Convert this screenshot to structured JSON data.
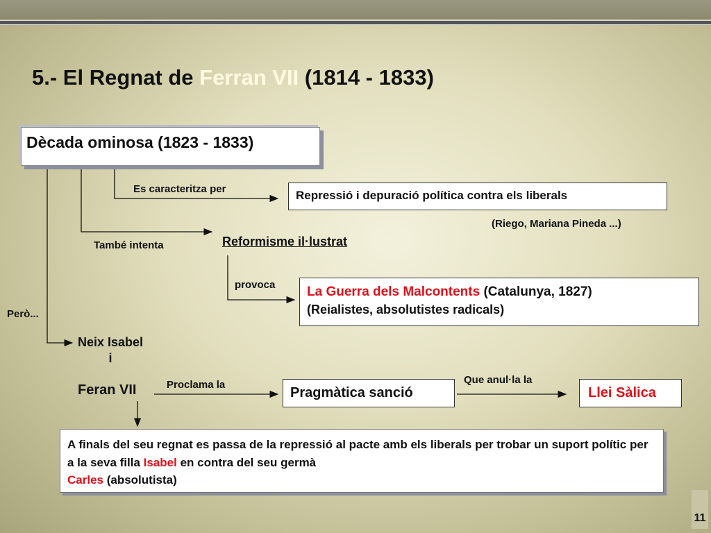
{
  "title": {
    "prefix": "5.- El Regnat de ",
    "highlight": "Ferran VII",
    "suffix": " (1814 - 1833)"
  },
  "decada": "Dècada ominosa (1823 - 1833)",
  "es_caracteritza": "Es caracteritza per",
  "repressio": "Repressió i depuració política contra els liberals",
  "riego": "(Riego, Mariana Pineda ...)",
  "tambe": "També intenta",
  "reformisme": "Reformisme il·lustrat",
  "provoca": "provoca",
  "guerra": {
    "red": "La Guerra dels Malcontents",
    "rest": " (Catalunya, 1827)",
    "line2": "(Reialistes, absolutistes radicals)"
  },
  "pero": "Però...",
  "neix": {
    "line1": "Neix Isabel",
    "line2": "i"
  },
  "feran": "Feran VII",
  "proclama": "Proclama la",
  "pragmatica": "Pragmàtica sanció",
  "que_anul": "Que anul·la la",
  "llei": "Llei Sàlica",
  "finals": {
    "p1": "A finals del seu regnat es passa de la repressió al pacte amb els liberals per trobar un suport polític per a la seva filla ",
    "isabel": "Isabel",
    "p2": "  en contra del seu germà ",
    "carles": "Carles",
    "p3": " (absolutista)"
  },
  "page_number": "11"
}
